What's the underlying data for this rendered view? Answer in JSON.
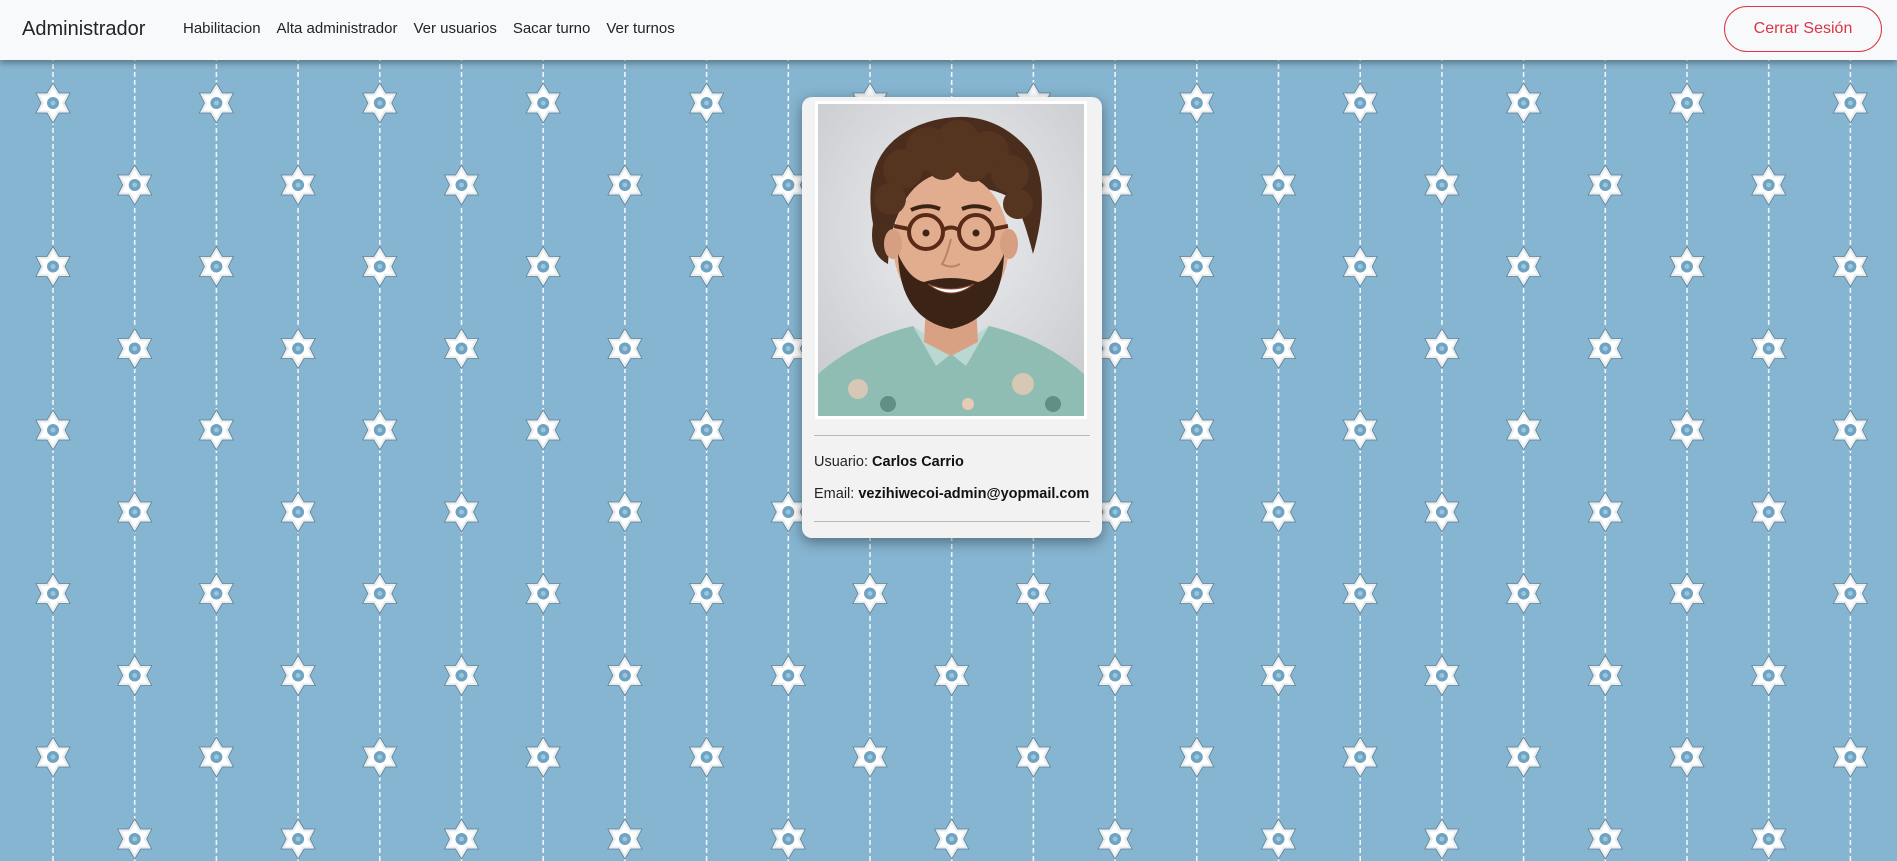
{
  "navbar": {
    "brand": "Administrador",
    "links": [
      "Habilitacion",
      "Alta administrador",
      "Ver usuarios",
      "Sacar turno",
      "Ver turnos"
    ],
    "logout_label": "Cerrar Sesión"
  },
  "profile": {
    "user_label": "Usuario:",
    "user_name": "Carlos Carrio",
    "email_label": "Email:",
    "email": "vezihiwecoi-admin@yopmail.com"
  },
  "colors": {
    "background": "#86b5d1",
    "logout_accent": "#dc3545",
    "navbar_bg": "#f8f9fa"
  },
  "icons": {
    "background_pattern": "star-ornament-icon",
    "profile_photo": "avatar"
  }
}
